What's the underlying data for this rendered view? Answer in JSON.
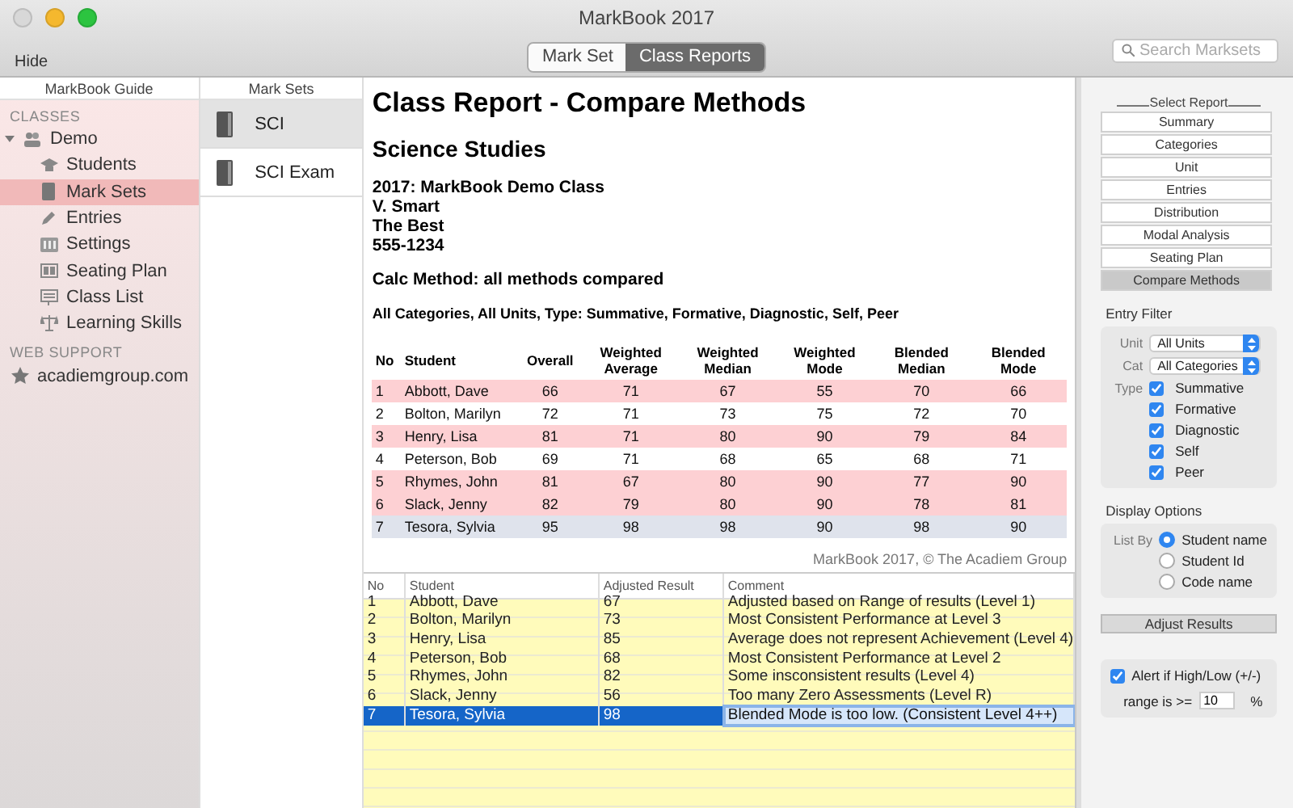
{
  "window": {
    "title": "MarkBook 2017"
  },
  "toolbar": {
    "hide_label": "Hide",
    "tabs": [
      {
        "label": "Mark Set",
        "selected": false
      },
      {
        "label": "Class Reports",
        "selected": true
      }
    ],
    "search": {
      "placeholder": "Search Marksets"
    }
  },
  "sidebar": {
    "header": "MarkBook Guide",
    "sections": [
      {
        "title": "CLASSES",
        "items": [
          {
            "label": "Demo",
            "selected": false,
            "expanded": true,
            "children": [
              {
                "label": "Students",
                "selected": false
              },
              {
                "label": "Mark Sets",
                "selected": true
              },
              {
                "label": "Entries",
                "selected": false
              },
              {
                "label": "Settings",
                "selected": false
              },
              {
                "label": "Seating Plan",
                "selected": false
              },
              {
                "label": "Class List",
                "selected": false
              },
              {
                "label": "Learning Skills",
                "selected": false
              }
            ]
          }
        ]
      },
      {
        "title": "WEB SUPPORT",
        "items": [
          {
            "label": "acadiemgroup.com",
            "selected": false
          }
        ]
      }
    ]
  },
  "mark_sets": {
    "header": "Mark Sets",
    "items": [
      {
        "label": "SCI",
        "selected": true
      },
      {
        "label": "SCI Exam",
        "selected": false
      }
    ]
  },
  "report": {
    "title": "Class Report - Compare Methods",
    "subtitle": "Science Studies",
    "info_lines": [
      "2017: MarkBook Demo Class",
      "V. Smart",
      "The Best",
      "555-1234"
    ],
    "calc_method": "Calc Method: all methods compared",
    "filter_line": "All Categories, All Units, Type: Summative, Formative, Diagnostic, Self, Peer",
    "columns": [
      "No",
      "Student",
      "Overall",
      "Weighted Average",
      "Weighted Median",
      "Weighted Mode",
      "Blended Median",
      "Blended Mode"
    ],
    "rows": [
      {
        "flagged": true,
        "selected": false,
        "cells": [
          "1",
          "Abbott, Dave",
          "66",
          "71",
          "67",
          "55",
          "70",
          "66"
        ]
      },
      {
        "flagged": false,
        "selected": false,
        "cells": [
          "2",
          "Bolton, Marilyn",
          "72",
          "71",
          "73",
          "75",
          "72",
          "70"
        ]
      },
      {
        "flagged": true,
        "selected": false,
        "cells": [
          "3",
          "Henry, Lisa",
          "81",
          "71",
          "80",
          "90",
          "79",
          "84"
        ]
      },
      {
        "flagged": false,
        "selected": false,
        "cells": [
          "4",
          "Peterson, Bob",
          "69",
          "71",
          "68",
          "65",
          "68",
          "71"
        ]
      },
      {
        "flagged": true,
        "selected": false,
        "cells": [
          "5",
          "Rhymes, John",
          "81",
          "67",
          "80",
          "90",
          "77",
          "90"
        ]
      },
      {
        "flagged": true,
        "selected": false,
        "cells": [
          "6",
          "Slack, Jenny",
          "82",
          "79",
          "80",
          "90",
          "78",
          "81"
        ]
      },
      {
        "flagged": false,
        "selected": true,
        "cells": [
          "7",
          "Tesora, Sylvia",
          "95",
          "98",
          "98",
          "90",
          "98",
          "90"
        ]
      }
    ],
    "footer": "MarkBook 2017, © The Acadiem Group"
  },
  "adjust_table": {
    "columns": [
      "No",
      "Student",
      "Adjusted Result",
      "Comment"
    ],
    "rows": [
      {
        "selected": false,
        "cells": [
          "1",
          "Abbott, Dave",
          "67",
          "Adjusted based on Range of results (Level 1)"
        ]
      },
      {
        "selected": false,
        "cells": [
          "2",
          "Bolton, Marilyn",
          "73",
          "Most Consistent Performance at Level 3"
        ]
      },
      {
        "selected": false,
        "cells": [
          "3",
          "Henry, Lisa",
          "85",
          "Average does not represent Achievement (Level 4)"
        ]
      },
      {
        "selected": false,
        "cells": [
          "4",
          "Peterson, Bob",
          "68",
          "Most Consistent Performance at Level 2"
        ]
      },
      {
        "selected": false,
        "cells": [
          "5",
          "Rhymes, John",
          "82",
          "Some insconsistent results (Level 4)"
        ]
      },
      {
        "selected": false,
        "cells": [
          "6",
          "Slack, Jenny",
          "56",
          "Too many Zero Assessments (Level R)"
        ]
      },
      {
        "selected": true,
        "cells": [
          "7",
          "Tesora, Sylvia",
          "98",
          "Blended Mode is too low. (Consistent Level 4++)"
        ]
      }
    ]
  },
  "panel": {
    "select_report": {
      "title": "Select Report",
      "buttons": [
        {
          "label": "Summary",
          "selected": false
        },
        {
          "label": "Categories",
          "selected": false
        },
        {
          "label": "Unit",
          "selected": false
        },
        {
          "label": "Entries",
          "selected": false
        },
        {
          "label": "Distribution",
          "selected": false
        },
        {
          "label": "Modal Analysis",
          "selected": false
        },
        {
          "label": "Seating Plan",
          "selected": false
        },
        {
          "label": "Compare Methods",
          "selected": true
        }
      ]
    },
    "entry_filter": {
      "title": "Entry Filter",
      "selects": [
        {
          "label": "Unit",
          "value": "All Units"
        },
        {
          "label": "Cat",
          "value": "All Categories"
        }
      ],
      "type_label": "Type",
      "types": [
        {
          "label": "Summative",
          "checked": true
        },
        {
          "label": "Formative",
          "checked": true
        },
        {
          "label": "Diagnostic",
          "checked": true
        },
        {
          "label": "Self",
          "checked": true
        },
        {
          "label": "Peer",
          "checked": true
        }
      ]
    },
    "display_options": {
      "title": "Display Options",
      "list_by_label": "List By",
      "options": [
        {
          "label": "Student name",
          "selected": true
        },
        {
          "label": "Student Id",
          "selected": false
        },
        {
          "label": "Code name",
          "selected": false
        }
      ]
    },
    "adjust_button": "Adjust Results",
    "alert": {
      "label": "Alert if High/Low (+/-)",
      "checked": true,
      "range_label": "range is >=",
      "range_value": "10",
      "unit": "%"
    }
  }
}
